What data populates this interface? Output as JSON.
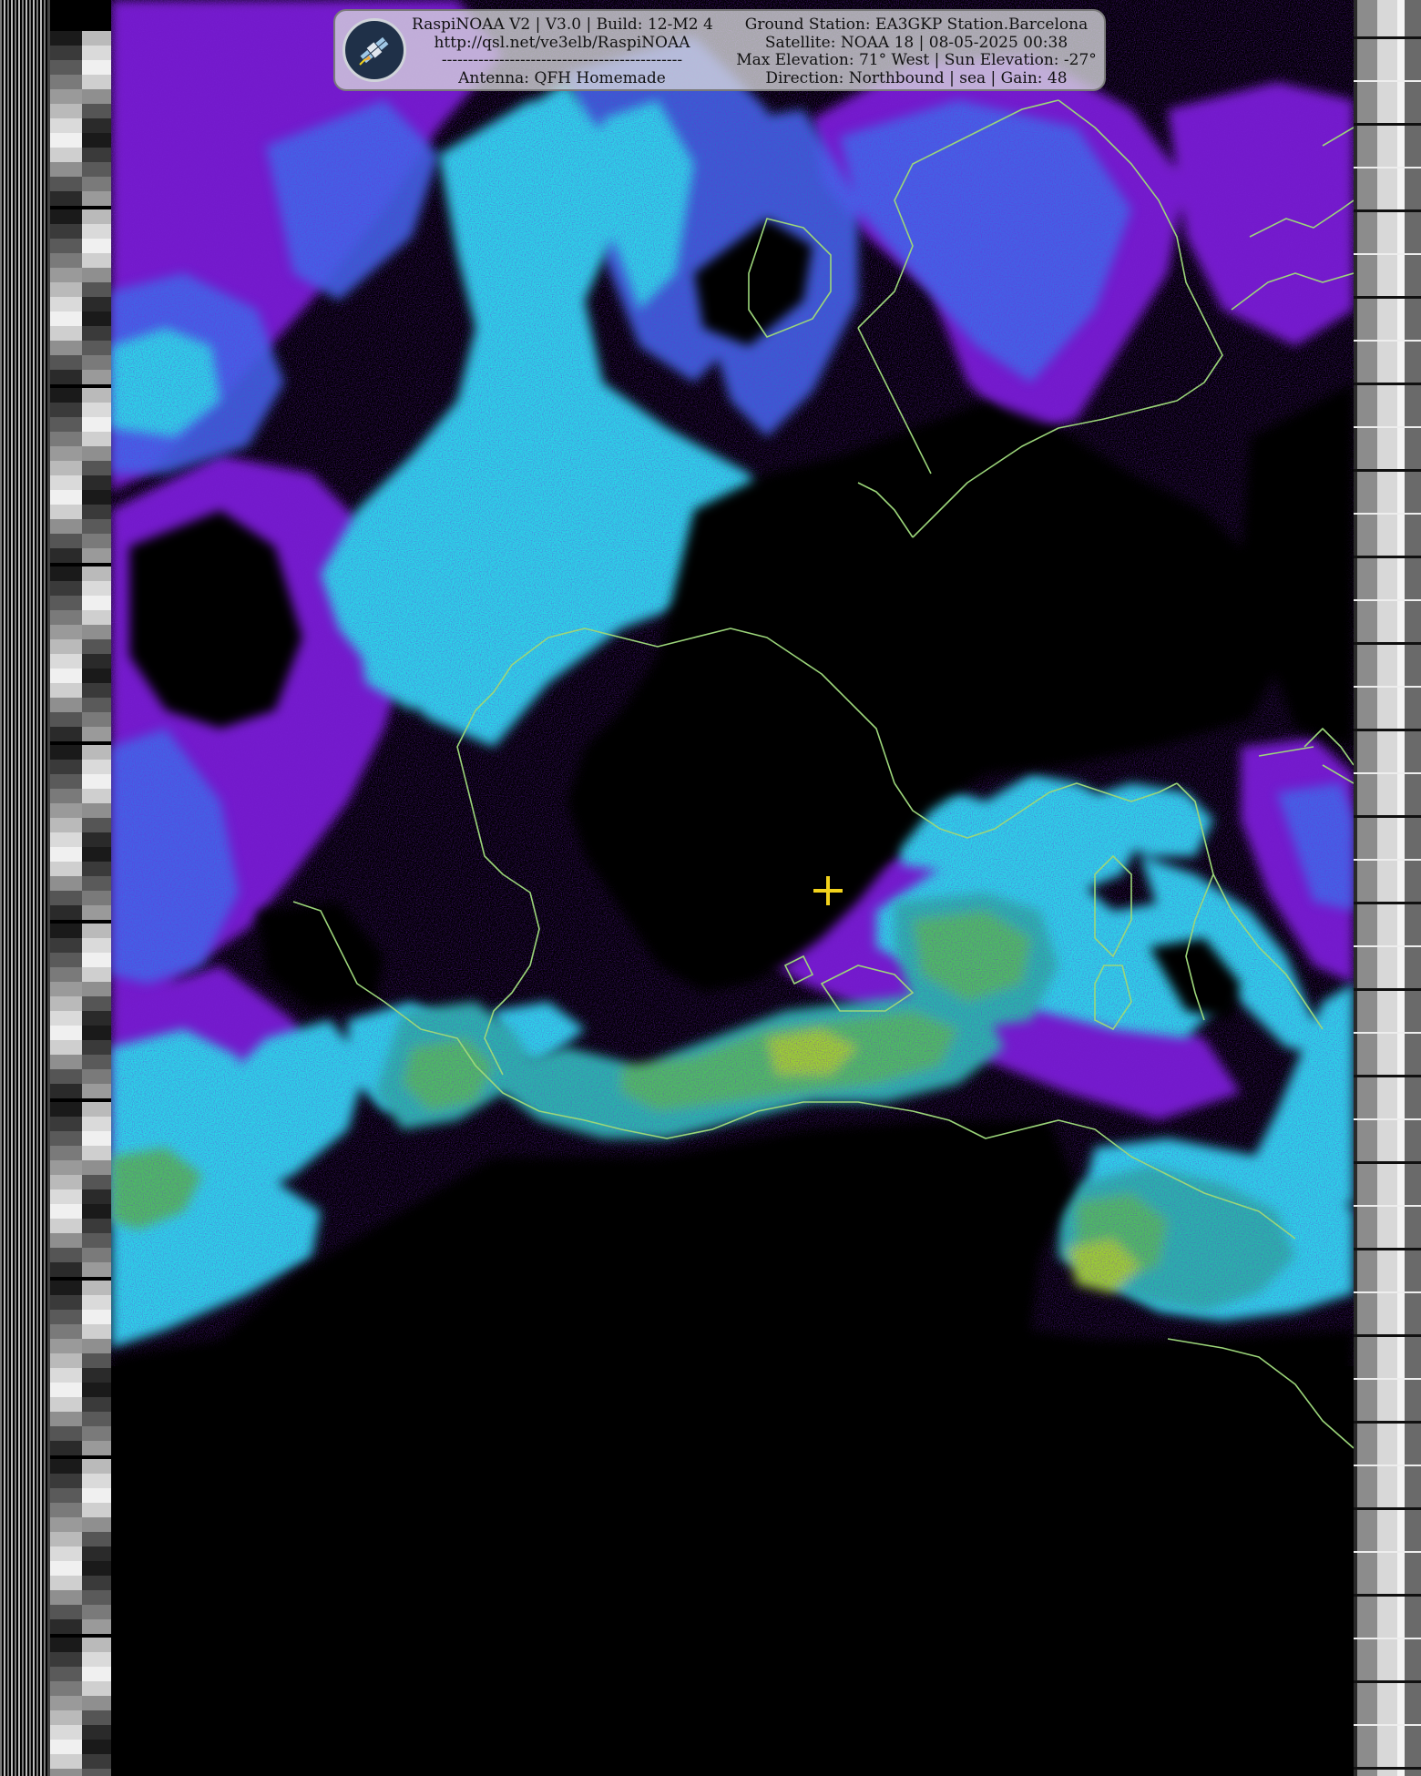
{
  "overlay": {
    "logo_icon": "satellite-icon",
    "left_lines": [
      "RaspiNOAA V2 | V3.0 | Build: 12-M2 4",
      "http://qsl.net/ve3elb/RaspiNOAA",
      "----------------------------------------------",
      "Antenna: QFH Homemade"
    ],
    "right_lines": [
      "Ground Station: EA3GKP Station.Barcelona",
      "Satellite: NOAA 18 | 08-05-2025 00:38",
      "Max Elevation: 71° West | Sun Elevation: -27°",
      "Direction: Northbound | sea | Gain: 48"
    ]
  },
  "image": {
    "palette": [
      "#000000",
      "#7a1fd6",
      "#3d6be8",
      "#29d6e6",
      "#27b8a8",
      "#4cc061",
      "#9bd42e"
    ],
    "coastline_color": "#9cd67a",
    "marker_color": "#f2d21c"
  }
}
